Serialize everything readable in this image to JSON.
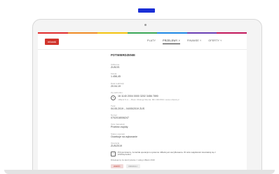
{
  "colors": {
    "tab_accent": "#1a2fd6",
    "brand": "#d0342c",
    "colorbar": [
      "#e12c2c",
      "#f08a24",
      "#f4c20d",
      "#3aa757",
      "#1e88e5",
      "#6a3fb5",
      "#c2185b"
    ]
  },
  "header": {
    "logo_text": "mbank",
    "nav": [
      {
        "label": "PLATY",
        "active": false
      },
      {
        "label": "PRZELEWY ˅",
        "active": true
      },
      {
        "label": "FINANSE ˅",
        "active": false
      },
      {
        "label": "OFERTY ˅",
        "active": false
      }
    ]
  },
  "page": {
    "title": "POTWIERDZENIE",
    "fields": [
      {
        "label": "Odbiorca",
        "value": "ZUSOS"
      },
      {
        "label": "Kwota",
        "value": "1.456,45"
      },
      {
        "label": "Data realizacji",
        "value": "20.04.19"
      },
      {
        "label": "Ze rachunku",
        "value": "16 1140 2004 0000 3202 3456 7890"
      },
      {
        "label": "Tytuł",
        "value": "04.05.2019 – 04/05/2019 ZUS"
      },
      {
        "label": "Numer",
        "value": "0702018006247"
      },
      {
        "label": "Opis transakcji",
        "value": "Przelew zwykły"
      },
      {
        "label": "Status operacji",
        "value": "Oczekuje na wykonanie"
      },
      {
        "label": "Operacja",
        "value": "ZUS/2019"
      }
    ],
    "bank_line": "mBank S.A. – Biuro Obsługi Klienta: 801 300 800 / www.mbank.pl",
    "note": "Przypominamy, że każda operacja w systemie mBank jest weryfikowana. W razie wątpliwości skontaktuj się z infolinią banku.",
    "footer": "Dziękujemy za skorzystanie z usług mBank 2019",
    "buttons": {
      "primary": "WRÓĆ",
      "secondary": "DRUKUJ"
    }
  }
}
